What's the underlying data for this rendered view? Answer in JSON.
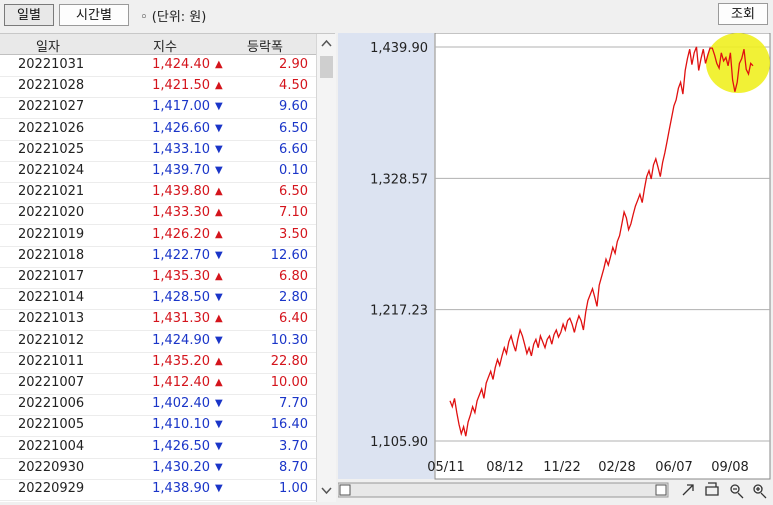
{
  "toolbar": {
    "tab_daily": "일별",
    "tab_hourly": "시간별",
    "unit_label": "◦ (단위: 원)",
    "search_button": "조회"
  },
  "table": {
    "headers": [
      "일자",
      "지수",
      "등락폭"
    ],
    "rows": [
      {
        "date": "20221031",
        "value": "1,424.40",
        "dir": "up",
        "change": "2.90"
      },
      {
        "date": "20221028",
        "value": "1,421.50",
        "dir": "up",
        "change": "4.50"
      },
      {
        "date": "20221027",
        "value": "1,417.00",
        "dir": "down",
        "change": "9.60"
      },
      {
        "date": "20221026",
        "value": "1,426.60",
        "dir": "down",
        "change": "6.50"
      },
      {
        "date": "20221025",
        "value": "1,433.10",
        "dir": "down",
        "change": "6.60"
      },
      {
        "date": "20221024",
        "value": "1,439.70",
        "dir": "down",
        "change": "0.10"
      },
      {
        "date": "20221021",
        "value": "1,439.80",
        "dir": "up",
        "change": "6.50"
      },
      {
        "date": "20221020",
        "value": "1,433.30",
        "dir": "up",
        "change": "7.10"
      },
      {
        "date": "20221019",
        "value": "1,426.20",
        "dir": "up",
        "change": "3.50"
      },
      {
        "date": "20221018",
        "value": "1,422.70",
        "dir": "down",
        "change": "12.60"
      },
      {
        "date": "20221017",
        "value": "1,435.30",
        "dir": "up",
        "change": "6.80"
      },
      {
        "date": "20221014",
        "value": "1,428.50",
        "dir": "down",
        "change": "2.80"
      },
      {
        "date": "20221013",
        "value": "1,431.30",
        "dir": "up",
        "change": "6.40"
      },
      {
        "date": "20221012",
        "value": "1,424.90",
        "dir": "down",
        "change": "10.30"
      },
      {
        "date": "20221011",
        "value": "1,435.20",
        "dir": "up",
        "change": "22.80"
      },
      {
        "date": "20221007",
        "value": "1,412.40",
        "dir": "up",
        "change": "10.00"
      },
      {
        "date": "20221006",
        "value": "1,402.40",
        "dir": "down",
        "change": "7.70"
      },
      {
        "date": "20221005",
        "value": "1,410.10",
        "dir": "down",
        "change": "16.40"
      },
      {
        "date": "20221004",
        "value": "1,426.50",
        "dir": "down",
        "change": "3.70"
      },
      {
        "date": "20220930",
        "value": "1,430.20",
        "dir": "down",
        "change": "8.70"
      },
      {
        "date": "20220929",
        "value": "1,438.90",
        "dir": "down",
        "change": "1.00"
      }
    ]
  },
  "chart_data": {
    "type": "line",
    "y_ticks": [
      "1,439.90",
      "1,328.57",
      "1,217.23",
      "1,105.90"
    ],
    "x_ticks": [
      "05/11",
      "08/12",
      "11/22",
      "02/28",
      "06/07",
      "09/08"
    ],
    "ylim": [
      1105.9,
      1439.9
    ],
    "grid": true,
    "line_color": "#e01010",
    "highlight_color": "#f0f020",
    "series": [
      {
        "values": [
          1140,
          1135,
          1142,
          1130,
          1120,
          1112,
          1118,
          1110,
          1122,
          1128,
          1135,
          1130,
          1140,
          1145,
          1150,
          1142,
          1155,
          1160,
          1165,
          1158,
          1168,
          1175,
          1170,
          1178,
          1185,
          1180,
          1190,
          1195,
          1188,
          1182,
          1192,
          1200,
          1195,
          1188,
          1180,
          1185,
          1178,
          1188,
          1192,
          1185,
          1195,
          1190,
          1185,
          1192,
          1195,
          1188,
          1196,
          1200,
          1194,
          1198,
          1205,
          1200,
          1208,
          1210,
          1205,
          1198,
          1206,
          1212,
          1208,
          1200,
          1215,
          1225,
          1230,
          1235,
          1228,
          1220,
          1238,
          1245,
          1252,
          1260,
          1255,
          1262,
          1270,
          1265,
          1275,
          1280,
          1290,
          1300,
          1295,
          1285,
          1290,
          1298,
          1305,
          1310,
          1315,
          1308,
          1320,
          1330,
          1335,
          1328,
          1340,
          1345,
          1338,
          1330,
          1342,
          1350,
          1360,
          1370,
          1380,
          1390,
          1395,
          1405,
          1410,
          1400,
          1420,
          1430,
          1438,
          1425,
          1435,
          1440,
          1420,
          1430,
          1438,
          1426,
          1433,
          1439,
          1439,
          1433,
          1426,
          1422,
          1435,
          1428,
          1431,
          1424,
          1435,
          1412,
          1402,
          1410,
          1426,
          1430,
          1438,
          1421,
          1417,
          1426,
          1424
        ]
      }
    ]
  },
  "chart_toolbar": {
    "icons": [
      "scroll-left-icon",
      "scroll-right-icon",
      "expand-icon",
      "print-icon",
      "zoom-out-icon",
      "zoom-in-icon"
    ]
  }
}
